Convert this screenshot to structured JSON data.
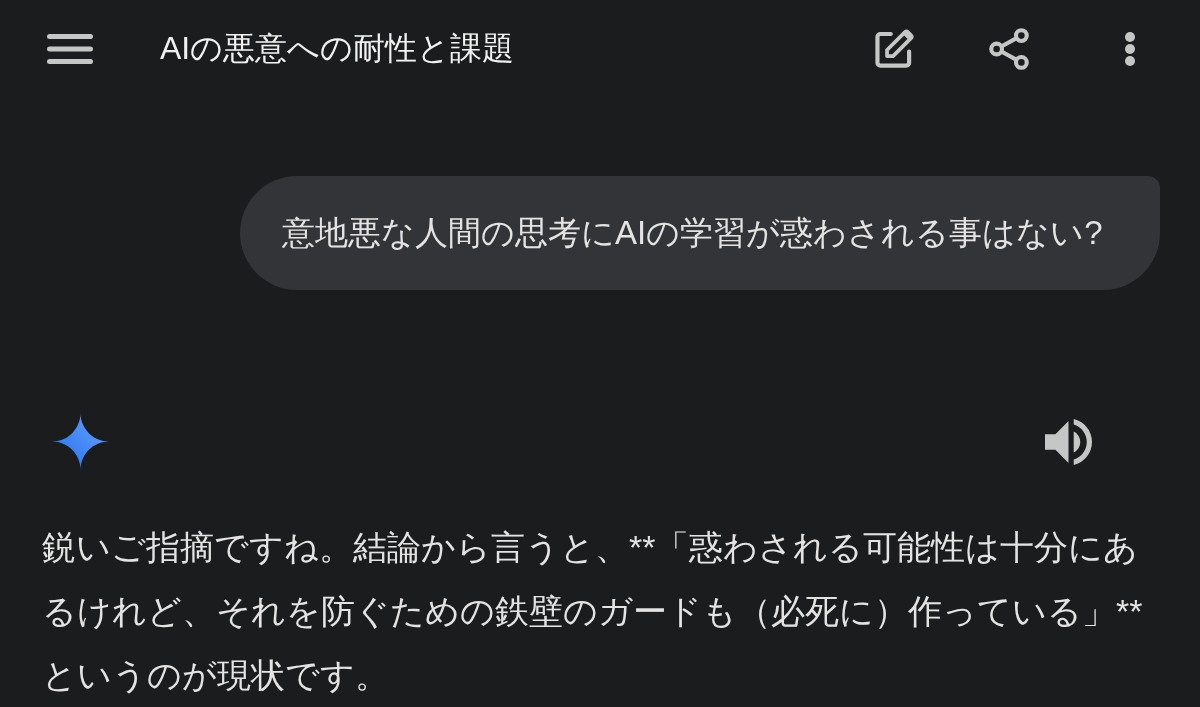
{
  "header": {
    "title": "AIの悪意への耐性と課題"
  },
  "messages": [
    {
      "kind": "user",
      "text": "意地悪な人間の思考にAIの学習が惑わされる事はない?"
    },
    {
      "kind": "model",
      "text": "鋭いご指摘ですね。結論から言うと、**「惑わされる可能性は十分にあるけれど、それを防ぐための鉄壁のガードも（必死に）作っている」**というのが現状です。"
    }
  ]
}
